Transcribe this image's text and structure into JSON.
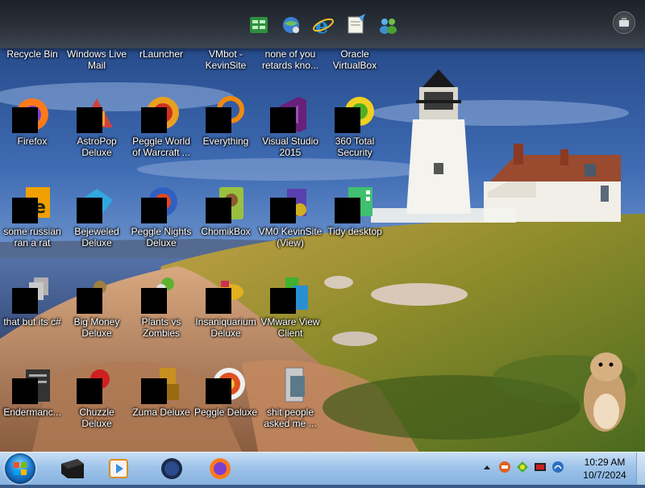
{
  "top_dock": {
    "icons": [
      "spreadsheet-icon",
      "globe-network-icon",
      "internet-explorer-icon",
      "notes-icon",
      "users-icon"
    ],
    "menu_icon": "briefcase-icon"
  },
  "partial_labels": [
    "Recycle Bin",
    "Windows Live\nMail",
    "rLauncher",
    "VMbot -\nKevinSite",
    "none of you\nretards kno...",
    "Oracle\nVirtualBox"
  ],
  "desktop_icons": [
    {
      "label": "Firefox",
      "icon": "firefox-icon",
      "color": "#ff7a1a"
    },
    {
      "label": "AstroPop\nDeluxe",
      "icon": "astropop-icon",
      "color": "#d04040"
    },
    {
      "label": "Peggle World\nof Warcraft ...",
      "icon": "peggle-wow-icon",
      "color": "#e8a020"
    },
    {
      "label": "Everything",
      "icon": "everything-icon",
      "color": "#f08a10"
    },
    {
      "label": "Visual Studio\n2015",
      "icon": "visual-studio-icon",
      "color": "#68217a"
    },
    {
      "label": "360 Total\nSecurity",
      "icon": "360-security-icon",
      "color": "#f0d020"
    },
    {
      "label": "some russian\nran a rat",
      "icon": "script-file-icon",
      "color": "#f0a000"
    },
    {
      "label": "Bejeweled\nDeluxe",
      "icon": "bejeweled-icon",
      "color": "#30a8e0"
    },
    {
      "label": "Peggle Nights\nDeluxe",
      "icon": "peggle-nights-icon",
      "color": "#e04820"
    },
    {
      "label": "ChomikBox",
      "icon": "chomikbox-icon",
      "color": "#9ac040"
    },
    {
      "label": "VM0 KevinSite\n(View)",
      "icon": "vm-view-icon",
      "color": "#5a3fb0"
    },
    {
      "label": "Tidy desktop",
      "icon": "tidy-desktop-icon",
      "color": "#40c070"
    },
    {
      "label": "that but its c#",
      "icon": "copy-files-icon",
      "color": "#b0b0b0"
    },
    {
      "label": "Big Money\nDeluxe",
      "icon": "big-money-icon",
      "color": "#a08040"
    },
    {
      "label": "Plants vs\nZombies",
      "icon": "plants-vs-zombies-icon",
      "color": "#60b030"
    },
    {
      "label": "Insaniquarium\nDeluxe",
      "icon": "insaniquarium-icon",
      "color": "#e0b020"
    },
    {
      "label": "VMware View\nClient",
      "icon": "vmware-view-icon",
      "color": "#2a8fd0"
    },
    {
      "label": "Endermanc...",
      "icon": "terminal-icon",
      "color": "#333333"
    },
    {
      "label": "Chuzzle\nDeluxe",
      "icon": "chuzzle-icon",
      "color": "#d02020"
    },
    {
      "label": "Zuma Deluxe",
      "icon": "zuma-icon",
      "color": "#c89020"
    },
    {
      "label": "Peggle Deluxe",
      "icon": "peggle-deluxe-icon",
      "color": "#e05020"
    },
    {
      "label": "shit people\nasked me ...",
      "icon": "folder-icon",
      "color": "#c8c8c8"
    }
  ],
  "taskbar": {
    "start_icon": "windows-start-orb-icon",
    "pinned": [
      "black-box-app-icon",
      "media-player-icon",
      "dark-globe-icon",
      "firefox-icon"
    ],
    "tray_icons": [
      "chevron-up-icon",
      "orange-app-icon",
      "green-diamond-icon",
      "red-monitor-icon",
      "network-icon"
    ],
    "time": "10:29 AM",
    "date": "10/7/2024"
  }
}
